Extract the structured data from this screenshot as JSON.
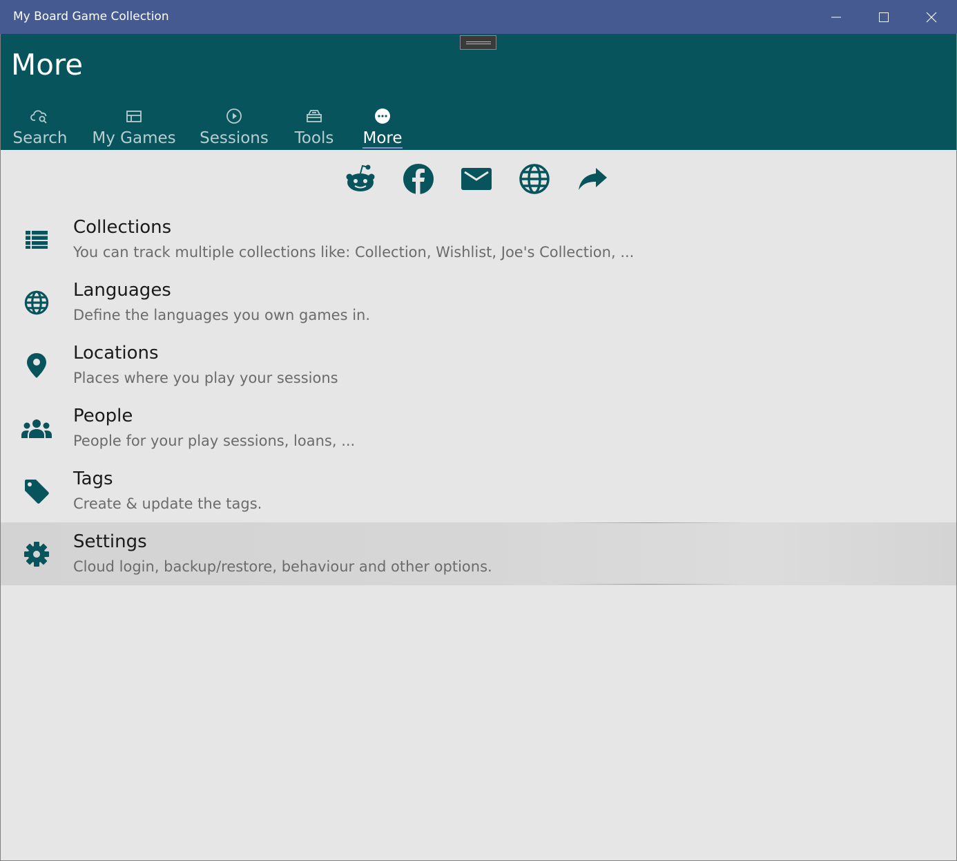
{
  "window": {
    "title": "My Board Game Collection",
    "controls": {
      "minimize_icon": "minimize-icon",
      "maximize_icon": "maximize-icon",
      "close_icon": "close-icon"
    }
  },
  "header": {
    "title": "More",
    "background": "#07545d"
  },
  "tabs": [
    {
      "label": "Search",
      "icon": "cloud-search-icon",
      "active": false
    },
    {
      "label": "My Games",
      "icon": "table-layout-icon",
      "active": false
    },
    {
      "label": "Sessions",
      "icon": "play-circle-icon",
      "active": false
    },
    {
      "label": "Tools",
      "icon": "toolbox-icon",
      "active": false
    },
    {
      "label": "More",
      "icon": "more-dots-icon",
      "active": true
    }
  ],
  "social": [
    {
      "icon": "reddit-icon"
    },
    {
      "icon": "facebook-icon"
    },
    {
      "icon": "email-icon"
    },
    {
      "icon": "globe-icon"
    },
    {
      "icon": "share-icon"
    }
  ],
  "menu": [
    {
      "title": "Collections",
      "description": "You can track multiple collections like: Collection, Wishlist, Joe's Collection, ...",
      "icon": "list-icon",
      "selected": false
    },
    {
      "title": "Languages",
      "description": "Define the languages you own games in.",
      "icon": "globe-icon",
      "selected": false
    },
    {
      "title": "Locations",
      "description": "Places where you play your sessions",
      "icon": "location-pin-icon",
      "selected": false
    },
    {
      "title": "People",
      "description": "People for your play sessions, loans, ...",
      "icon": "people-icon",
      "selected": false
    },
    {
      "title": "Tags",
      "description": "Create & update the tags.",
      "icon": "tag-icon",
      "selected": false
    },
    {
      "title": "Settings",
      "description": "Cloud login, backup/restore, behaviour and other options.",
      "icon": "gear-icon",
      "selected": true
    }
  ],
  "colors": {
    "titlebar": "#455a90",
    "accent": "#07545d",
    "content_background": "#e6e6e6",
    "selected_row": "#d4d4d4"
  }
}
